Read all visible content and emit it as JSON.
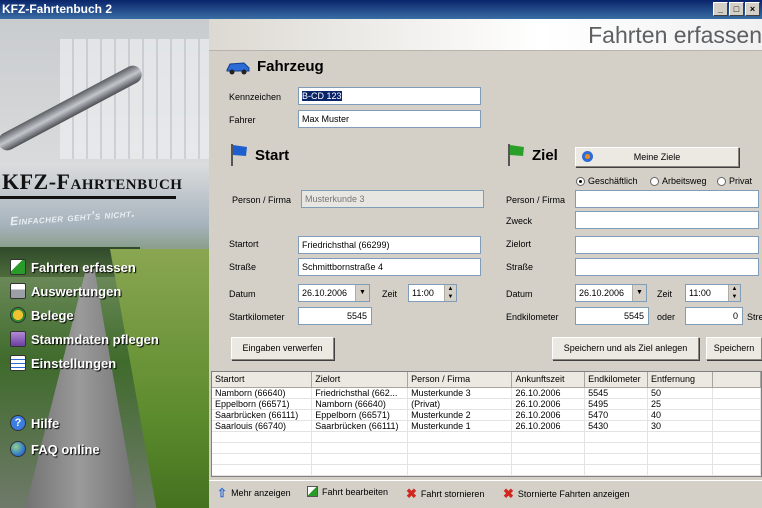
{
  "window": {
    "title": "KFZ-Fahrtenbuch 2"
  },
  "sidebar": {
    "logo": "KFZ-Fahrtenbuch",
    "slogan": "Einfacher geht's nicht.",
    "items": [
      {
        "label": "Fahrten erfassen",
        "icon": "edit-icon"
      },
      {
        "label": "Auswertungen",
        "icon": "printer-icon"
      },
      {
        "label": "Belege",
        "icon": "coins-icon"
      },
      {
        "label": "Stammdaten pflegen",
        "icon": "database-icon"
      },
      {
        "label": "Einstellungen",
        "icon": "checklist-icon"
      }
    ],
    "help": [
      {
        "label": "Hilfe",
        "icon": "help-icon"
      },
      {
        "label": "FAQ online",
        "icon": "globe-icon"
      }
    ]
  },
  "header": {
    "title": "Fahrten erfassen"
  },
  "vehicle": {
    "heading": "Fahrzeug",
    "plate_label": "Kennzeichen",
    "plate_value": "B-CD 123",
    "driver_label": "Fahrer",
    "driver_value": "Max Muster"
  },
  "start": {
    "heading": "Start",
    "person_label": "Person / Firma",
    "person_value": "Musterkunde 3",
    "city_label": "Startort",
    "city_value": "Friedrichsthal (66299)",
    "street_label": "Straße",
    "street_value": "Schmittbornstraße 4",
    "date_label": "Datum",
    "date_value": "26.10.2006",
    "time_label": "Zeit",
    "time_value": "11:00",
    "km_label": "Startkilometer",
    "km_value": "5545"
  },
  "destination": {
    "heading": "Ziel",
    "my_targets_button": "Meine Ziele",
    "trip_types": [
      {
        "label": "Geschäftlich",
        "selected": true
      },
      {
        "label": "Arbeitsweg",
        "selected": false
      },
      {
        "label": "Privat",
        "selected": false
      }
    ],
    "person_label": "Person / Firma",
    "purpose_label": "Zweck",
    "city_label": "Zielort",
    "street_label": "Straße",
    "date_label": "Datum",
    "date_value": "26.10.2006",
    "time_label": "Zeit",
    "time_value": "11:00",
    "km_label": "Endkilometer",
    "km_value": "5545",
    "or_label": "oder",
    "distance_value": "0",
    "distance_label": "Strecke"
  },
  "actions": {
    "discard": "Eingaben verwerfen",
    "save_as_target": "Speichern und als Ziel anlegen",
    "save": "Speichern"
  },
  "trips": {
    "columns": [
      "Startort",
      "Zielort",
      "Person / Firma",
      "Ankunftszeit",
      "Endkilometer",
      "Entfernung"
    ],
    "rows": [
      [
        "Namborn (66640)",
        "Friedrichsthal (662...",
        "Musterkunde 3",
        "26.10.2006",
        "5545",
        "50"
      ],
      [
        "Eppelborn (66571)",
        "Namborn (66640)",
        "(Privat)",
        "26.10.2006",
        "5495",
        "25"
      ],
      [
        "Saarbrücken (66111)",
        "Eppelborn (66571)",
        "Musterkunde 2",
        "26.10.2006",
        "5470",
        "40"
      ],
      [
        "Saarlouis (66740)",
        "Saarbrücken (66111)",
        "Musterkunde 1",
        "26.10.2006",
        "5430",
        "30"
      ]
    ]
  },
  "toolbar": {
    "more": "Mehr anzeigen",
    "edit": "Fahrt bearbeiten",
    "cancel_trip": "Fahrt stornieren",
    "show_cancelled": "Stornierte Fahrten anzeigen"
  },
  "colors": {
    "accent_blue": "#2d6bd6",
    "flag_green": "#2aa02a",
    "flag_blue": "#1e5fd0",
    "cancel_red": "#d0271e"
  }
}
